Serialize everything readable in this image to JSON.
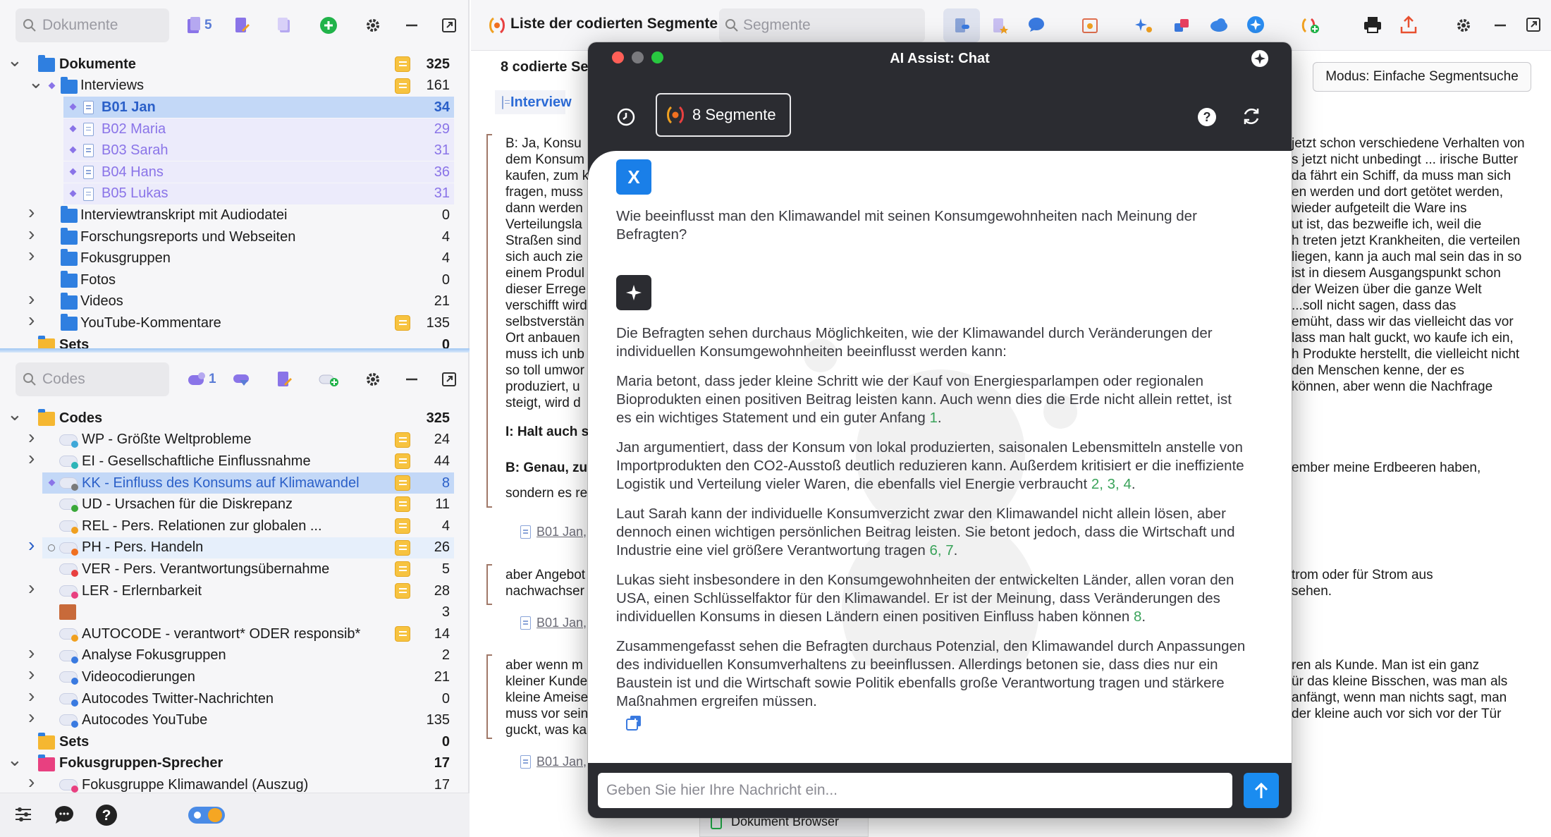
{
  "documents_panel": {
    "search_placeholder": "Dokumente",
    "toolbar_count": "5",
    "tree": [
      {
        "label": "Dokumente",
        "count": "325",
        "bold": true
      },
      {
        "label": "Interviews",
        "count": "161"
      },
      {
        "label": "B01 Jan",
        "count": "34",
        "selected": true
      },
      {
        "label": "B02 Maria",
        "count": "29"
      },
      {
        "label": "B03 Sarah",
        "count": "31"
      },
      {
        "label": "B04 Hans",
        "count": "36"
      },
      {
        "label": "B05 Lukas",
        "count": "31"
      },
      {
        "label": "Interviewtranskript mit Audiodatei",
        "count": "0"
      },
      {
        "label": "Forschungsreports und Webseiten",
        "count": "4"
      },
      {
        "label": "Fokusgruppen",
        "count": "4"
      },
      {
        "label": "Fotos",
        "count": "0"
      },
      {
        "label": "Videos",
        "count": "21"
      },
      {
        "label": "YouTube-Kommentare",
        "count": "135"
      },
      {
        "label": "Sets",
        "count": "0",
        "bold": true
      }
    ]
  },
  "codes_panel": {
    "search_placeholder": "Codes",
    "toolbar_count": "1",
    "tree": [
      {
        "label": "Codes",
        "count": "325",
        "bold": true
      },
      {
        "label": "WP - Größte Weltprobleme",
        "count": "24",
        "color": "#3fa8d8"
      },
      {
        "label": "EI - Gesellschaftliche Einflussnahme",
        "count": "44",
        "color": "#2db5b8"
      },
      {
        "label": "KK - Einfluss des Konsums auf Klimawandel",
        "count": "8",
        "color": "#7a7a7a",
        "selected": true
      },
      {
        "label": "UD - Ursachen für die Diskrepanz",
        "count": "11",
        "color": "#3aa83a"
      },
      {
        "label": "REL - Pers. Relationen zur globalen ...",
        "count": "4",
        "color": "#f0a020"
      },
      {
        "label": "PH - Pers. Handeln",
        "count": "26",
        "color": "#f07020",
        "highlight": true
      },
      {
        "label": "VER - Pers. Verantwortungsübernahme",
        "count": "5",
        "color": "#e84040"
      },
      {
        "label": "LER - Erlernbarkeit",
        "count": "28",
        "color": "#e84080"
      },
      {
        "label": "",
        "count": "3"
      },
      {
        "label": "AUTOCODE - verantwort* ODER responsib*",
        "count": "14",
        "color": "#f0a020"
      },
      {
        "label": "Analyse Fokusgruppen",
        "count": "2",
        "color": "#3a7ae0"
      },
      {
        "label": "Videocodierungen",
        "count": "21",
        "color": "#3a7ae0"
      },
      {
        "label": "Autocodes Twitter-Nachrichten",
        "count": "0",
        "color": "#3a7ae0"
      },
      {
        "label": "Autocodes YouTube",
        "count": "135",
        "color": "#3a7ae0"
      },
      {
        "label": "Sets",
        "count": "0",
        "bold": true
      },
      {
        "label": "Fokusgruppen-Sprecher",
        "count": "17",
        "bold": true
      },
      {
        "label": "Fokusgruppe Klimawandel (Auszug)",
        "count": "17",
        "color": "#e84080"
      }
    ]
  },
  "main": {
    "title": "Liste der codierten Segmente",
    "search_placeholder": "Segmente",
    "segments_heading": "8 codierte Se",
    "group_label": "Interview",
    "mode_button": "Modus: Einfache Segmentsuche",
    "left_snippets": [
      "B: Ja, Konsu\ndem Konsum\nkaufen, zum k\nfragen, muss\ndann werden\nVerteilungsla\nStraßen sind\nsich auch zie\neinem Produl\ndieser Errege\nverschifft wird\nselbstverstän\nOrt anbauen\nmuss ich unb\nso toll umwor\nproduziert, u\nsteigt, wird d",
      "I: Halt auch s",
      "B: Genau, zu",
      "sondern es re",
      "aber Angebot\nnachwachser",
      "aber wenn m\nkleiner Kunde\nkleine Ameise\nmuss vor sein\nguckt, was ka"
    ],
    "right_snippets": [
      "jetzt schon verschiedene Verhalten von\ns jetzt nicht unbedingt ... irische Butter\nda fährt ein Schiff, da muss man sich\nen werden und dort getötet werden,\nwieder aufgeteilt die Ware ins\nut ist, das bezweifle ich, weil die\nh treten jetzt Krankheiten, die verteilen\nliegen, kann ja auch mal sein das in so\nist in diesem Ausgangspunkt schon\nder Weizen über die ganze Welt\n...soll nicht sagen, dass das\nemüht, dass wir das vielleicht das vor\nlass man halt guckt, wo kaufe ich ein,\nh Produkte herstellt, die vielleicht nicht\nden Menschen kenne, der es\nkönnen, aber wenn die Nachfrage",
      "ember meine Erdbeeren haben,",
      "trom oder für Strom aus\nsehen.",
      "ren als Kunde. Man ist ein ganz\nür das kleine Bisschen, was man als\nanfängt, wenn man nichts sagt, man\nder kleine auch vor sich vor der Tür"
    ],
    "source_links": [
      "B01 Jan,",
      "B01 Jan,",
      "B01 Jan,"
    ],
    "bottom_tab": "Dokument Browser"
  },
  "chat": {
    "window_title": "AI Assist: Chat",
    "segments_button": "8 Segmente",
    "user_avatar": "X",
    "question": "Wie beeinflusst man den Klimawandel mit seinen Konsumgewohnheiten nach Meinung der Befragten?",
    "answer_intro": "Die Befragten sehen durchaus Möglichkeiten, wie der Klimawandel durch Veränderungen der individuellen Konsumgewohnheiten beeinflusst werden kann:",
    "p_maria": "Maria betont, dass jeder kleine Schritt wie der Kauf von Energiesparlampen oder regionalen Bioprodukten einen positiven Beitrag leisten kann. Auch wenn dies die Erde nicht allein rettet, ist es ein wichtiges Statement und ein guter Anfang",
    "p_maria_refs": "1",
    "p_jan": "Jan argumentiert, dass der Konsum von lokal produzierten, saisonalen Lebensmitteln anstelle von Importprodukten den CO2-Ausstoß deutlich reduzieren kann. Außerdem kritisiert er die ineffiziente Logistik und Verteilung vieler Waren, die ebenfalls viel Energie verbraucht",
    "p_jan_refs": "2, 3, 4",
    "p_sarah": "Laut Sarah kann der individuelle Konsumverzicht zwar den Klimawandel nicht allein lösen, aber dennoch einen wichtigen persönlichen Beitrag leisten. Sie betont jedoch, dass die Wirtschaft und Industrie eine viel größere Verantwortung tragen",
    "p_sarah_refs": "6, 7",
    "p_lukas": "Lukas sieht insbesondere in den Konsumgewohnheiten der entwickelten Länder, allen voran den USA, einen Schlüsselfaktor für den Klimawandel. Er ist der Meinung, dass Veränderungen des individuellen Konsums in diesen Ländern einen positiven Einfluss haben können",
    "p_lukas_refs": "8",
    "p_summary": "Zusammengefasst sehen die Befragten durchaus Potenzial, den Klimawandel durch Anpassungen des individuellen Konsumverhaltens zu beeinflussen. Allerdings betonen sie, dass dies nur ein Baustein ist und die Wirtschaft sowie Politik ebenfalls große Verantwortung tragen und stärkere Maßnahmen ergreifen müssen.",
    "input_placeholder": "Geben Sie hier Ihre Nachricht ein..."
  },
  "colors": {
    "accent": "#1a7fe8",
    "selection": "#c9def9",
    "purple_row": "#ecebfb"
  }
}
